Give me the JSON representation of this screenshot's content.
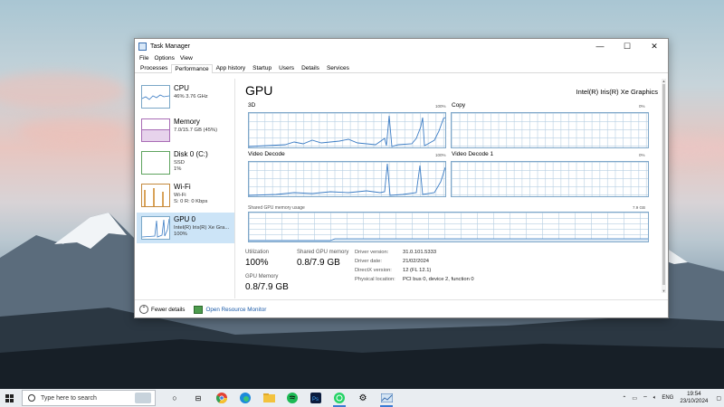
{
  "window": {
    "title": "Task Manager",
    "menu": [
      "File",
      "Options",
      "View"
    ],
    "tabs": [
      {
        "label": "Processes",
        "active": false
      },
      {
        "label": "Performance",
        "active": true
      },
      {
        "label": "App history",
        "active": false
      },
      {
        "label": "Startup",
        "active": false
      },
      {
        "label": "Users",
        "active": false
      },
      {
        "label": "Details",
        "active": false
      },
      {
        "label": "Services",
        "active": false
      }
    ]
  },
  "sidebar": {
    "items": [
      {
        "title": "CPU",
        "line1": "46%  3.76 GHz",
        "line2": "",
        "active": false
      },
      {
        "title": "Memory",
        "line1": "7.0/15.7 GB (45%)",
        "line2": "",
        "active": false
      },
      {
        "title": "Disk 0 (C:)",
        "line1": "SSD",
        "line2": "1%",
        "active": false
      },
      {
        "title": "Wi-Fi",
        "line1": "Wi-Fi",
        "line2": "S: 0  R: 0 Kbps",
        "active": false
      },
      {
        "title": "GPU 0",
        "line1": "Intel(R) Iris(R) Xe Gra...",
        "line2": "100%",
        "active": true
      }
    ]
  },
  "gpu": {
    "title": "GPU",
    "model": "Intel(R) Iris(R) Xe Graphics",
    "graphs": {
      "g3d": {
        "label": "3D",
        "max": "100%"
      },
      "copy": {
        "label": "Copy",
        "max": "0%"
      },
      "vdecode": {
        "label": "Video Decode",
        "max": "100%"
      },
      "vdecode1": {
        "label": "Video Decode 1",
        "max": "0%"
      },
      "shared": {
        "label": "Shared GPU memory usage",
        "max": "7.9 GB"
      }
    },
    "stats": {
      "utilization_label": "Utilization",
      "utilization_value": "100%",
      "shared_label": "Shared GPU memory",
      "shared_value": "0.8/7.9 GB",
      "gpu_mem_label": "GPU Memory",
      "gpu_mem_value": "0.8/7.9 GB"
    },
    "info": {
      "driver_version_label": "Driver version:",
      "driver_version": "31.0.101.5333",
      "driver_date_label": "Driver date:",
      "driver_date": "21/02/2024",
      "directx_label": "DirectX version:",
      "directx": "12 (FL 12.1)",
      "location_label": "Physical location:",
      "location": "PCI bus 0, device 2, function 0"
    }
  },
  "footer": {
    "fewer_details": "Fewer details",
    "resource_monitor": "Open Resource Monitor"
  },
  "taskbar": {
    "search_placeholder": "Type here to search",
    "tray_lang": "ENG",
    "time": "19:54",
    "date": "23/10/2024"
  }
}
